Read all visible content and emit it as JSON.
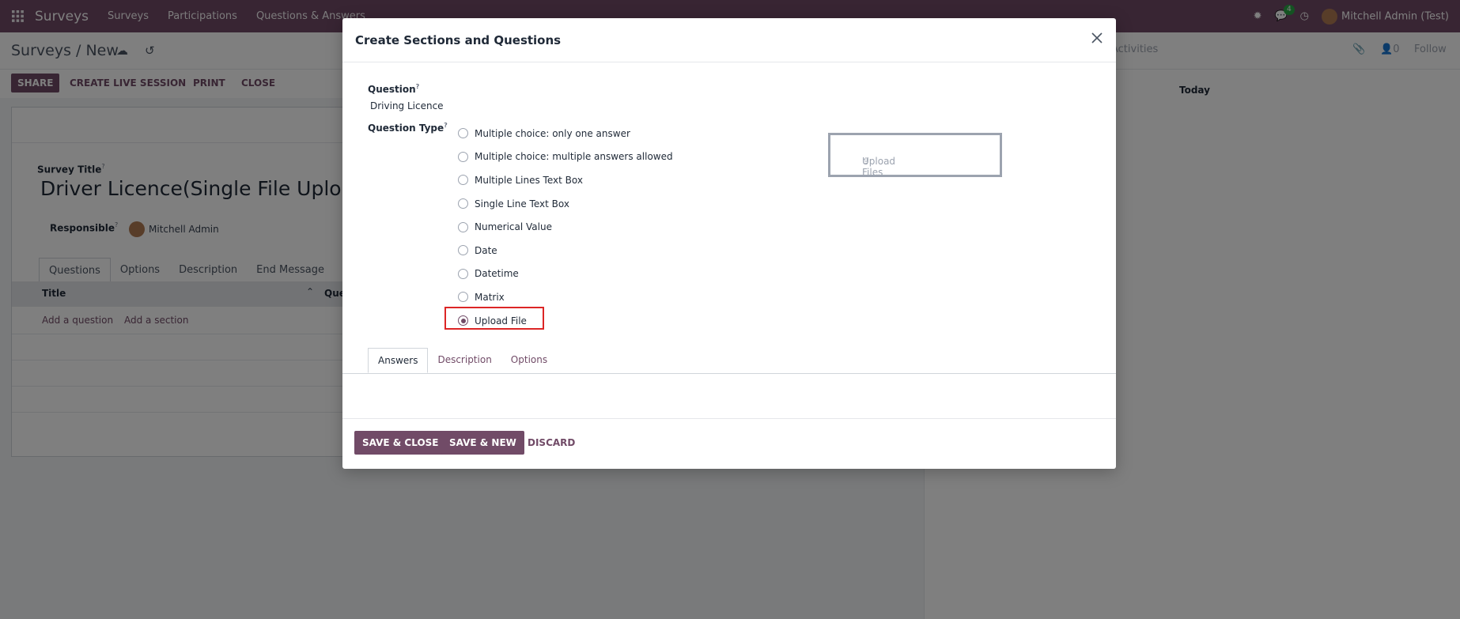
{
  "topbar": {
    "brand": "Surveys",
    "nav": [
      "Surveys",
      "Participations",
      "Questions & Answers"
    ],
    "chat_count": "4",
    "user": "Mitchell Admin (Test)"
  },
  "control_panel": {
    "breadcrumb": "Surveys / New",
    "activities": "Activities",
    "followers": "0",
    "follow": "Follow"
  },
  "actions": {
    "share": "SHARE",
    "create_live_session": "CREATE LIVE SESSION",
    "print": "PRINT",
    "close": "CLOSE"
  },
  "form": {
    "survey_title_label": "Survey Title",
    "survey_title_value": "Driver Licence(Single File Upload",
    "responsible_label": "Responsible",
    "responsible_value": "Mitchell Admin",
    "tabs": [
      "Questions",
      "Options",
      "Description",
      "End Message"
    ],
    "table_header_title": "Title",
    "table_header_partial": "Que",
    "add_question": "Add a question",
    "add_section": "Add a section"
  },
  "chatter": {
    "today": "Today"
  },
  "modal": {
    "title": "Create Sections and Questions",
    "question_label": "Question",
    "question_value": "Driving Licence",
    "question_type_label": "Question Type",
    "help_mark": "?",
    "question_types": [
      "Multiple choice: only one answer",
      "Multiple choice: multiple answers allowed",
      "Multiple Lines Text Box",
      "Single Line Text Box",
      "Numerical Value",
      "Date",
      "Datetime",
      "Matrix",
      "Upload File"
    ],
    "selected_type": "Upload File",
    "upload_preview": "Upload Files",
    "tabs": [
      "Answers",
      "Description",
      "Options"
    ],
    "save_close": "SAVE & CLOSE",
    "save_new": "SAVE & NEW",
    "discard": "DISCARD"
  },
  "colors": {
    "brand": "#714b67",
    "highlight": "#dc2626"
  }
}
